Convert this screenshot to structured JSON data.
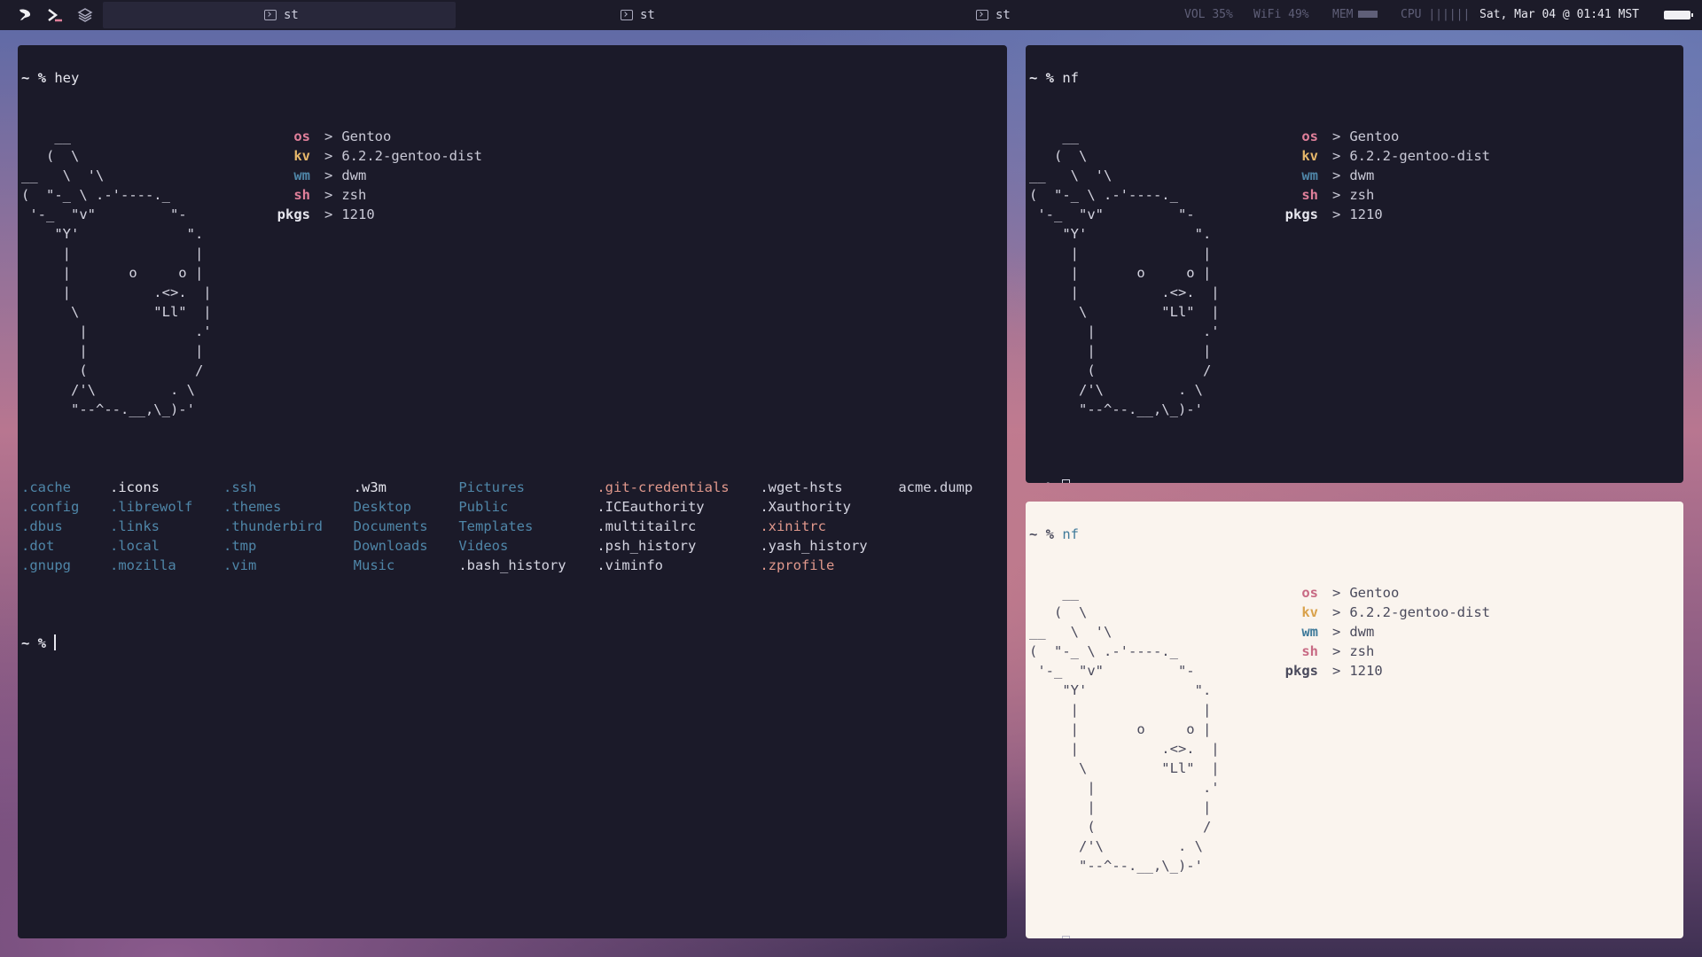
{
  "bar": {
    "tabs": [
      {
        "label": "st",
        "active": true
      },
      {
        "label": "st",
        "active": false
      },
      {
        "label": "st",
        "active": false
      }
    ],
    "vol_label": "VOL",
    "vol_value": "35%",
    "wifi_label": "WiFi",
    "wifi_value": "49%",
    "mem_label": "MEM",
    "cpu_label": "CPU",
    "cpu_bars": "||||||",
    "datetime": "Sat, Mar 04 @ 01:41 MST"
  },
  "term_left": {
    "prompt": "~ %",
    "command": "hey",
    "ascii": "    __\n   (  \\\n__   \\  '\\\n(  \"-_ \\ .-'----._\n '-_  \"v\"         \"-\n    \"Y'             \".\n     |               |\n     |       o     o |\n     |          .<>.  |\n      \\         \"Ll\"  |\n       |             .'\n       |             |\n       (             /\n      /'\\         . \\\n      \"--^--.__,\\_)-'",
    "info": [
      {
        "key": "os",
        "value": "Gentoo",
        "color": "#e07f9a"
      },
      {
        "key": "kv",
        "value": "6.2.2-gentoo-dist",
        "color": "#e6b76a"
      },
      {
        "key": "wm",
        "value": "dwm",
        "color": "#4f86a8"
      },
      {
        "key": "sh",
        "value": "zsh",
        "color": "#e07f9a"
      },
      {
        "key": "pkgs",
        "value": "1210",
        "color": "#e6e6ee"
      }
    ],
    "ls": [
      {
        "name": ".cache",
        "color": "#4f86a8"
      },
      {
        "name": ".config",
        "color": "#4f86a8"
      },
      {
        "name": ".dbus",
        "color": "#4f86a8"
      },
      {
        "name": ".dot",
        "color": "#4f86a8"
      },
      {
        "name": ".gnupg",
        "color": "#4f86a8"
      },
      {
        "name": ".icons",
        "color": "#e6e6ee"
      },
      {
        "name": ".librewolf",
        "color": "#4f86a8"
      },
      {
        "name": ".links",
        "color": "#4f86a8"
      },
      {
        "name": ".local",
        "color": "#4f86a8"
      },
      {
        "name": ".mozilla",
        "color": "#4f86a8"
      },
      {
        "name": ".ssh",
        "color": "#4f86a8"
      },
      {
        "name": ".themes",
        "color": "#4f86a8"
      },
      {
        "name": ".thunderbird",
        "color": "#4f86a8"
      },
      {
        "name": ".tmp",
        "color": "#4f86a8"
      },
      {
        "name": ".vim",
        "color": "#4f86a8"
      },
      {
        "name": ".w3m",
        "color": "#e6e6ee"
      },
      {
        "name": "Desktop",
        "color": "#4f86a8"
      },
      {
        "name": "Documents",
        "color": "#4f86a8"
      },
      {
        "name": "Downloads",
        "color": "#4f86a8"
      },
      {
        "name": "Music",
        "color": "#4f86a8"
      },
      {
        "name": "Pictures",
        "color": "#4f86a8"
      },
      {
        "name": "Public",
        "color": "#4f86a8"
      },
      {
        "name": "Templates",
        "color": "#4f86a8"
      },
      {
        "name": "Videos",
        "color": "#4f86a8"
      },
      {
        "name": ".bash_history",
        "color": "#d4d4e0"
      },
      {
        "name": ".git-credentials",
        "color": "#e0988c"
      },
      {
        "name": ".ICEauthority",
        "color": "#d4d4e0"
      },
      {
        "name": ".multitailrc",
        "color": "#d4d4e0"
      },
      {
        "name": ".psh_history",
        "color": "#d4d4e0"
      },
      {
        "name": ".viminfo",
        "color": "#d4d4e0"
      },
      {
        "name": ".wget-hsts",
        "color": "#d4d4e0"
      },
      {
        "name": ".Xauthority",
        "color": "#d4d4e0"
      },
      {
        "name": ".xinitrc",
        "color": "#e0988c"
      },
      {
        "name": ".yash_history",
        "color": "#d4d4e0"
      },
      {
        "name": ".zprofile",
        "color": "#e0988c"
      },
      {
        "name": "acme.dump",
        "color": "#d4d4e0"
      }
    ],
    "prompt2": "~ %"
  },
  "term_right_top": {
    "prompt": "~ %",
    "command": "nf",
    "info": [
      {
        "key": "os",
        "value": "Gentoo",
        "color": "#e07f9a"
      },
      {
        "key": "kv",
        "value": "6.2.2-gentoo-dist",
        "color": "#e6b76a"
      },
      {
        "key": "wm",
        "value": "dwm",
        "color": "#4f86a8"
      },
      {
        "key": "sh",
        "value": "zsh",
        "color": "#e07f9a"
      },
      {
        "key": "pkgs",
        "value": "1210",
        "color": "#e6e6ee"
      }
    ],
    "prompt2": "~ %"
  },
  "term_right_bottom": {
    "prompt": "~ %",
    "command": "nf",
    "info": [
      {
        "key": "os",
        "value": "Gentoo",
        "color": "#c86a84"
      },
      {
        "key": "kv",
        "value": "6.2.2-gentoo-dist",
        "color": "#d9a24c"
      },
      {
        "key": "wm",
        "value": "dwm",
        "color": "#3f7a9a"
      },
      {
        "key": "sh",
        "value": "zsh",
        "color": "#c86a84"
      },
      {
        "key": "pkgs",
        "value": "1210",
        "color": "#4a4a5c"
      }
    ],
    "prompt2": "~ %"
  }
}
